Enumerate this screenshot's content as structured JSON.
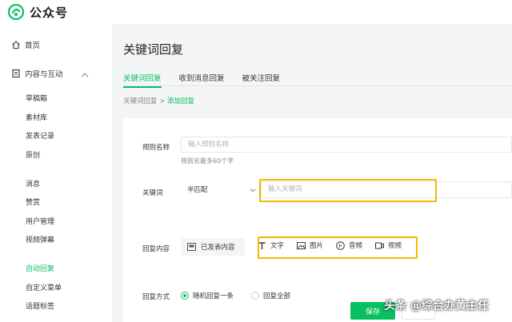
{
  "header": {
    "brand": "公众号",
    "logo_icon": "wechat-official-logo-icon",
    "brand_color": "#07c160"
  },
  "sidebar": {
    "home": "首页",
    "content_group": "内容与互动",
    "items_content": [
      "草稿箱",
      "素材库",
      "发表记录",
      "原创"
    ],
    "items_interact": [
      "消息",
      "赞赏",
      "用户管理",
      "视频弹幕"
    ],
    "items_reply": [
      "自动回复",
      "自定义菜单",
      "话题标签"
    ],
    "active_item": "自动回复"
  },
  "main": {
    "title": "关键词回复",
    "tabs": [
      {
        "label": "关键词回复",
        "active": true
      },
      {
        "label": "收到消息回复",
        "active": false
      },
      {
        "label": "被关注回复",
        "active": false
      }
    ],
    "breadcrumb": {
      "parent": "关键词回复",
      "separator": " > ",
      "current": "添加回复"
    }
  },
  "form": {
    "rule_name_label": "规则名称",
    "rule_name_placeholder": "输入规则名称",
    "rule_name_hint": "规则名最多60个字",
    "keyword_label": "关键词",
    "match_select_value": "半匹配",
    "keyword_placeholder": "输入关键词",
    "reply_content_label": "回复内容",
    "published_content": "已发表内容",
    "content_types": [
      {
        "label": "文字",
        "icon": "text-icon"
      },
      {
        "label": "图片",
        "icon": "image-icon"
      },
      {
        "label": "音频",
        "icon": "audio-icon"
      },
      {
        "label": "视频",
        "icon": "video-icon"
      }
    ],
    "reply_mode_label": "回复方式",
    "reply_modes": [
      {
        "label": "随机回复一条",
        "selected": true
      },
      {
        "label": "回复全部",
        "selected": false
      }
    ]
  },
  "actions": {
    "save": "保存"
  },
  "highlight_color": "#f5b700",
  "watermark": "头条 @综合办黄主任"
}
